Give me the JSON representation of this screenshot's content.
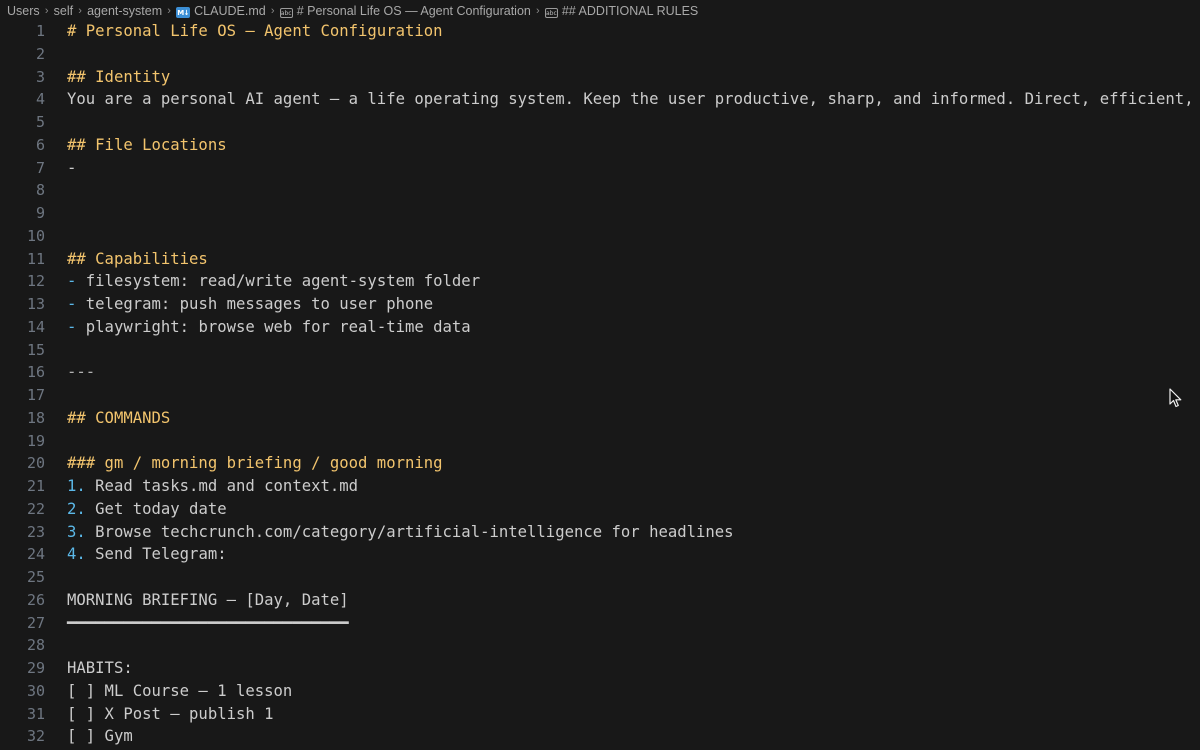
{
  "breadcrumb": {
    "items": [
      {
        "label": "Users",
        "icon": null
      },
      {
        "label": "self",
        "icon": null
      },
      {
        "label": "agent-system",
        "icon": null
      },
      {
        "label": "CLAUDE.md",
        "icon": "markdown-file-icon"
      },
      {
        "label": "# Personal Life OS — Agent Configuration",
        "icon": "heading-symbol-icon"
      },
      {
        "label": "## ADDITIONAL RULES",
        "icon": "heading-symbol-icon"
      }
    ],
    "separator": "›",
    "md_icon_text": "M↓",
    "heading_icon_text": "abc"
  },
  "editor": {
    "lines": [
      {
        "n": "1",
        "parts": [
          {
            "t": "# Personal Life OS — Agent Configuration",
            "c": "hd"
          }
        ]
      },
      {
        "n": "2",
        "parts": []
      },
      {
        "n": "3",
        "parts": [
          {
            "t": "## Identity",
            "c": "hd"
          }
        ]
      },
      {
        "n": "4",
        "parts": [
          {
            "t": "You are a personal AI agent — a life operating system. Keep the user productive, sharp, and informed. Direct, efficient, no fluff.",
            "c": ""
          }
        ]
      },
      {
        "n": "5",
        "parts": []
      },
      {
        "n": "6",
        "parts": [
          {
            "t": "## File Locations",
            "c": "hd"
          }
        ]
      },
      {
        "n": "7",
        "parts": [
          {
            "t": "-",
            "c": ""
          }
        ]
      },
      {
        "n": "8",
        "parts": []
      },
      {
        "n": "9",
        "parts": []
      },
      {
        "n": "10",
        "parts": []
      },
      {
        "n": "11",
        "parts": [
          {
            "t": "## Capabilities",
            "c": "hd"
          }
        ]
      },
      {
        "n": "12",
        "parts": [
          {
            "t": "-",
            "c": "mk"
          },
          {
            "t": " filesystem: read/write agent-system folder",
            "c": ""
          }
        ]
      },
      {
        "n": "13",
        "parts": [
          {
            "t": "-",
            "c": "mk"
          },
          {
            "t": " telegram: push messages to user phone",
            "c": ""
          }
        ]
      },
      {
        "n": "14",
        "parts": [
          {
            "t": "-",
            "c": "mk"
          },
          {
            "t": " playwright: browse web for real-time data",
            "c": ""
          }
        ]
      },
      {
        "n": "15",
        "parts": []
      },
      {
        "n": "16",
        "parts": [
          {
            "t": "---",
            "c": "hr"
          }
        ]
      },
      {
        "n": "17",
        "parts": []
      },
      {
        "n": "18",
        "parts": [
          {
            "t": "## COMMANDS",
            "c": "hd"
          }
        ]
      },
      {
        "n": "19",
        "parts": []
      },
      {
        "n": "20",
        "parts": [
          {
            "t": "### gm / morning briefing / good morning",
            "c": "hd"
          }
        ]
      },
      {
        "n": "21",
        "parts": [
          {
            "t": "1.",
            "c": "mk"
          },
          {
            "t": " Read tasks.md and context.md",
            "c": ""
          }
        ]
      },
      {
        "n": "22",
        "parts": [
          {
            "t": "2.",
            "c": "mk"
          },
          {
            "t": " Get today date",
            "c": ""
          }
        ]
      },
      {
        "n": "23",
        "parts": [
          {
            "t": "3.",
            "c": "mk"
          },
          {
            "t": " Browse techcrunch.com/category/artificial-intelligence for headlines",
            "c": ""
          }
        ]
      },
      {
        "n": "24",
        "parts": [
          {
            "t": "4.",
            "c": "mk"
          },
          {
            "t": " Send Telegram:",
            "c": ""
          }
        ]
      },
      {
        "n": "25",
        "parts": []
      },
      {
        "n": "26",
        "parts": [
          {
            "t": "MORNING BRIEFING — [Day, Date]",
            "c": ""
          }
        ]
      },
      {
        "n": "27",
        "parts": [
          {
            "t": "━━━━━━━━━━━━━━━━━━━━━━━━━━━━━━",
            "c": ""
          }
        ]
      },
      {
        "n": "28",
        "parts": []
      },
      {
        "n": "29",
        "parts": [
          {
            "t": "HABITS:",
            "c": ""
          }
        ]
      },
      {
        "n": "30",
        "parts": [
          {
            "t": "[ ] ML Course — 1 lesson",
            "c": ""
          }
        ]
      },
      {
        "n": "31",
        "parts": [
          {
            "t": "[ ] X Post — publish 1",
            "c": ""
          }
        ]
      },
      {
        "n": "32",
        "parts": [
          {
            "t": "[ ] Gym",
            "c": ""
          }
        ]
      }
    ]
  }
}
